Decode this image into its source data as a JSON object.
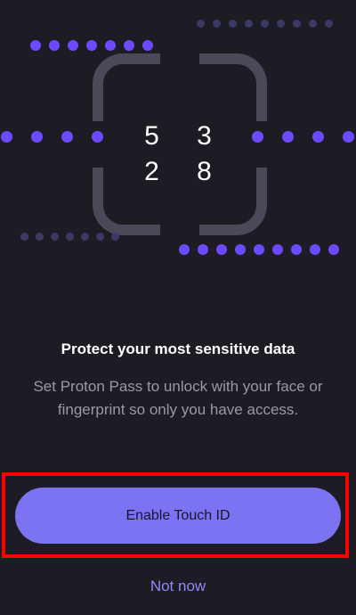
{
  "illustration": {
    "pin_code": "5 3 2 8",
    "accent_color": "#6d4aff",
    "muted_dot_color": "#3b3a66",
    "frame_color": "#4b4857"
  },
  "content": {
    "title": "Protect your most sensitive data",
    "description": "Set Proton Pass to unlock with your face or fingerprint so only you have access."
  },
  "actions": {
    "primary_label": "Enable Touch ID",
    "secondary_label": "Not now",
    "primary_color": "#7b73f2",
    "highlight_color": "#ff0000"
  }
}
